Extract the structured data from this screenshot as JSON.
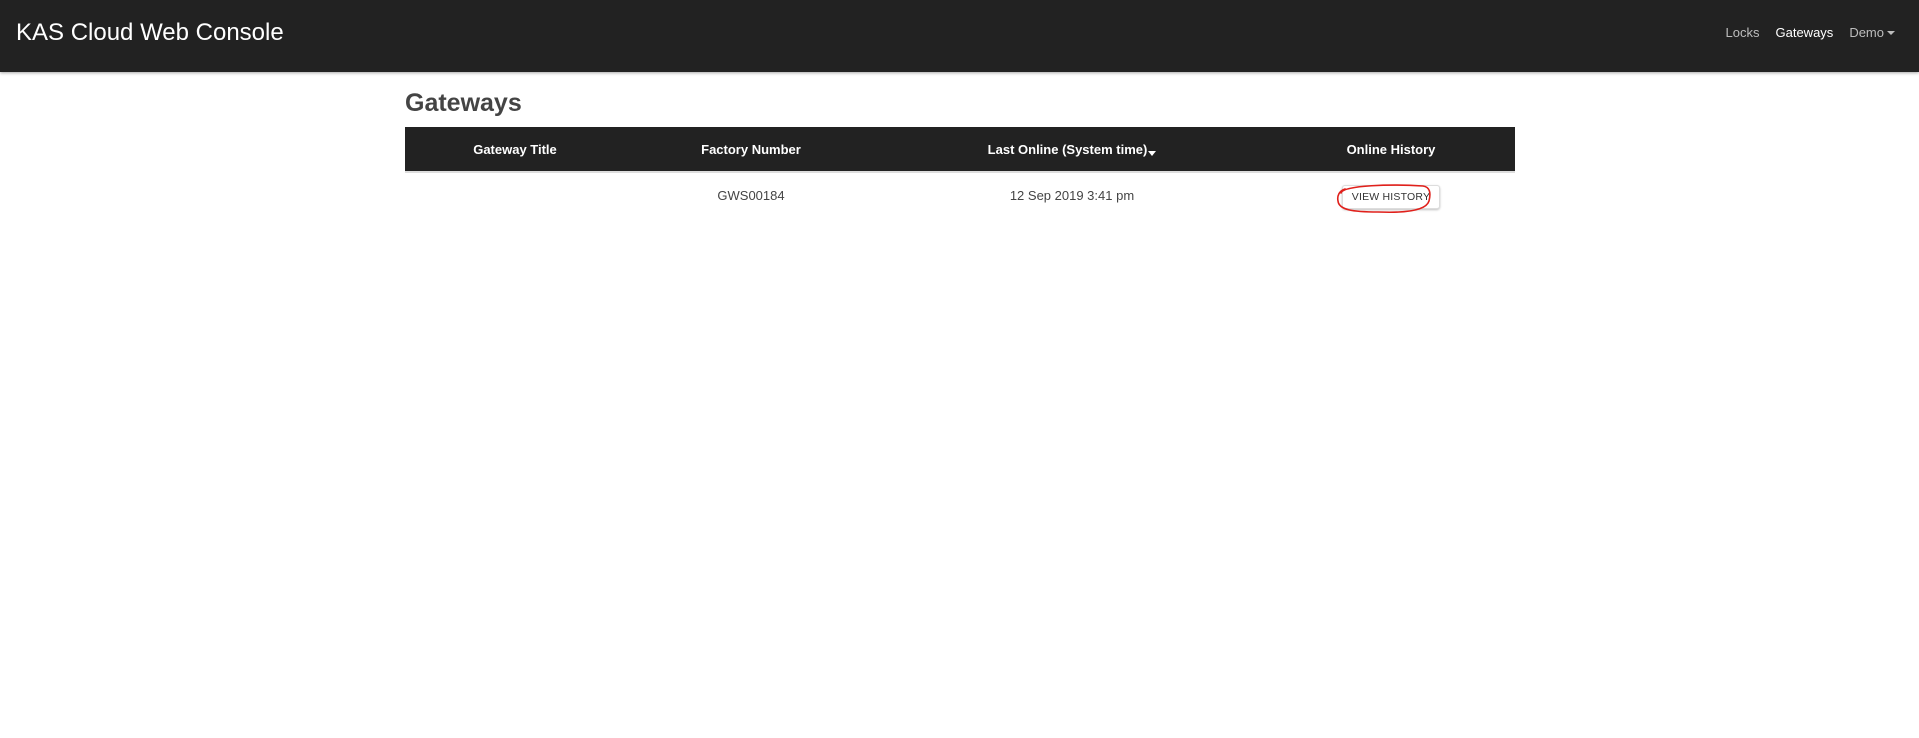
{
  "navbar": {
    "brand": "KAS Cloud Web Console",
    "links": [
      {
        "label": "Locks"
      },
      {
        "label": "Gateways"
      },
      {
        "label": "Demo"
      }
    ]
  },
  "page": {
    "title": "Gateways"
  },
  "table": {
    "headers": [
      "Gateway Title",
      "Factory Number",
      "Last Online (System time)",
      "Online History"
    ],
    "rows": [
      {
        "gateway_title": "",
        "factory_number": "GWS00184",
        "last_online": "12 Sep 2019 3:41 pm",
        "history_button": "VIEW HISTORY"
      }
    ]
  },
  "colors": {
    "navbar_bg": "#222222",
    "annotation_ring": "#e0201b"
  }
}
